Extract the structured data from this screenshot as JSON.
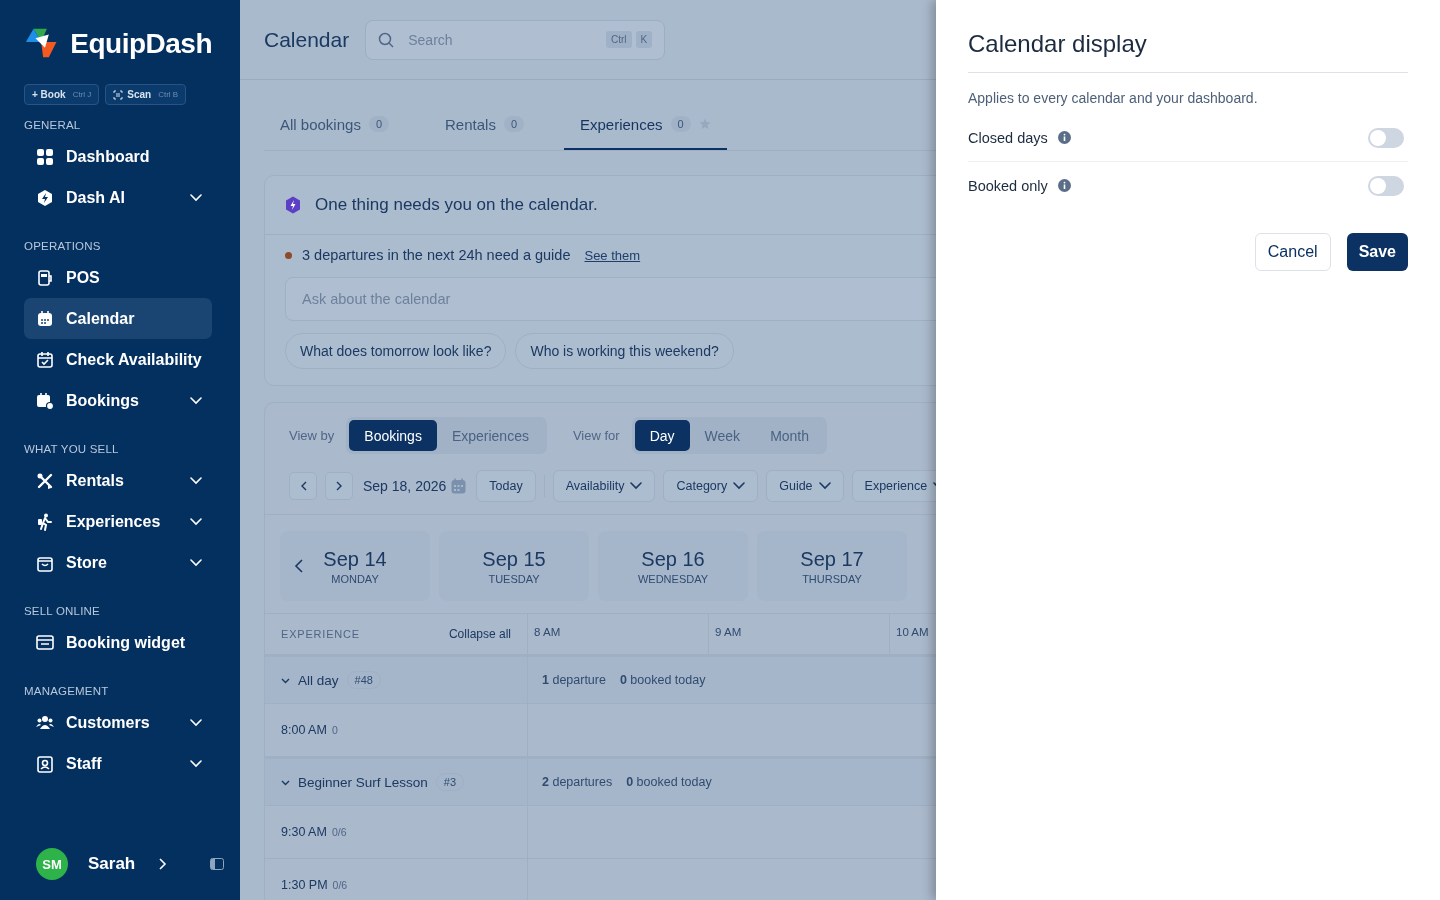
{
  "sidebar": {
    "brand": "EquipDash",
    "quick_actions": [
      {
        "kind": "book",
        "label": "+ Book",
        "shortcut": "Ctrl J"
      },
      {
        "kind": "scan",
        "label": "Scan",
        "shortcut": "Ctrl B"
      }
    ],
    "sections": [
      {
        "title": "GENERAL",
        "items": [
          {
            "kind": "dashboard",
            "label": "Dashboard",
            "has_submenu": false,
            "selected": false
          },
          {
            "kind": "ai",
            "label": "Dash AI",
            "has_submenu": true,
            "selected": false
          }
        ]
      },
      {
        "title": "OPERATIONS",
        "items": [
          {
            "kind": "pos",
            "label": "POS",
            "has_submenu": false,
            "selected": false
          },
          {
            "kind": "calendar",
            "label": "Calendar",
            "has_submenu": false,
            "selected": true
          },
          {
            "kind": "check",
            "label": "Check Availability",
            "has_submenu": false,
            "selected": false
          },
          {
            "kind": "bookings",
            "label": "Bookings",
            "has_submenu": true,
            "selected": false
          }
        ]
      },
      {
        "title": "WHAT YOU SELL",
        "items": [
          {
            "kind": "rentals",
            "label": "Rentals",
            "has_submenu": true,
            "selected": false
          },
          {
            "kind": "experiences",
            "label": "Experiences",
            "has_submenu": true,
            "selected": false
          },
          {
            "kind": "store",
            "label": "Store",
            "has_submenu": true,
            "selected": false
          }
        ]
      },
      {
        "title": "SELL ONLINE",
        "items": [
          {
            "kind": "widget",
            "label": "Booking widget",
            "has_submenu": false,
            "selected": false
          }
        ]
      },
      {
        "title": "MANAGEMENT",
        "items": [
          {
            "kind": "customers",
            "label": "Customers",
            "has_submenu": true,
            "selected": false
          },
          {
            "kind": "staff",
            "label": "Staff",
            "has_submenu": true,
            "selected": false
          }
        ]
      }
    ],
    "user": {
      "initials": "SM",
      "name": "Sarah"
    }
  },
  "main": {
    "title": "Calendar",
    "search": {
      "placeholder": "Search",
      "keys": [
        "Ctrl",
        "K"
      ]
    },
    "tabs": [
      {
        "label": "All bookings",
        "count": "0",
        "selected": false,
        "star": false
      },
      {
        "label": "Rentals",
        "count": "0",
        "selected": false,
        "star": false
      },
      {
        "label": "Experiences",
        "count": "0",
        "selected": true,
        "star": true
      }
    ],
    "assistant": {
      "title": "One thing needs you on the calendar.",
      "alerts": [
        {
          "text": "3 departures in the next 24h need a guide",
          "link": "See them"
        }
      ],
      "ask_placeholder": "Ask about the calendar",
      "suggestions": [
        "What does tomorrow look like?",
        "Who is working this weekend?"
      ]
    },
    "view_by": {
      "label": "View by",
      "options": [
        {
          "label": "Bookings",
          "selected": true
        },
        {
          "label": "Experiences",
          "selected": false
        }
      ]
    },
    "view_for": {
      "label": "View for",
      "options": [
        {
          "label": "Day",
          "selected": true
        },
        {
          "label": "Week",
          "selected": false
        },
        {
          "label": "Month",
          "selected": false
        }
      ]
    },
    "date": "Sep 18, 2026",
    "today": "Today",
    "filters": [
      "Availability",
      "Category",
      "Guide",
      "Experience"
    ],
    "days": [
      {
        "date": "Sep 14",
        "weekday": "MONDAY"
      },
      {
        "date": "Sep 15",
        "weekday": "TUESDAY"
      },
      {
        "date": "Sep 16",
        "weekday": "WEDNESDAY"
      },
      {
        "date": "Sep 17",
        "weekday": "THURSDAY"
      }
    ],
    "timeline": {
      "column_label": "EXPERIENCE",
      "collapse": "Collapse all",
      "hours": [
        "8 AM",
        "9 AM",
        "10 AM"
      ],
      "groups": [
        {
          "name": "All day",
          "tag": "#48",
          "expanded": true,
          "departures": "**1** departure",
          "booked": "**0** booked today",
          "slots": [
            {
              "time": "8:00 AM",
              "capacity": "0"
            }
          ]
        },
        {
          "name": "Beginner Surf Lesson",
          "tag": "#3",
          "expanded": true,
          "departures": "**2** departures",
          "booked": "**0** booked today",
          "slots": [
            {
              "time": "9:30 AM",
              "capacity": "0/6"
            },
            {
              "time": "1:30 PM",
              "capacity": "0/6"
            }
          ]
        }
      ]
    }
  },
  "panel": {
    "title": "Calendar display",
    "description": "Applies to every calendar and your dashboard.",
    "settings": [
      {
        "label": "Closed days",
        "on": false
      },
      {
        "label": "Booked only",
        "on": false
      }
    ],
    "cancel": "Cancel",
    "save": "Save"
  }
}
